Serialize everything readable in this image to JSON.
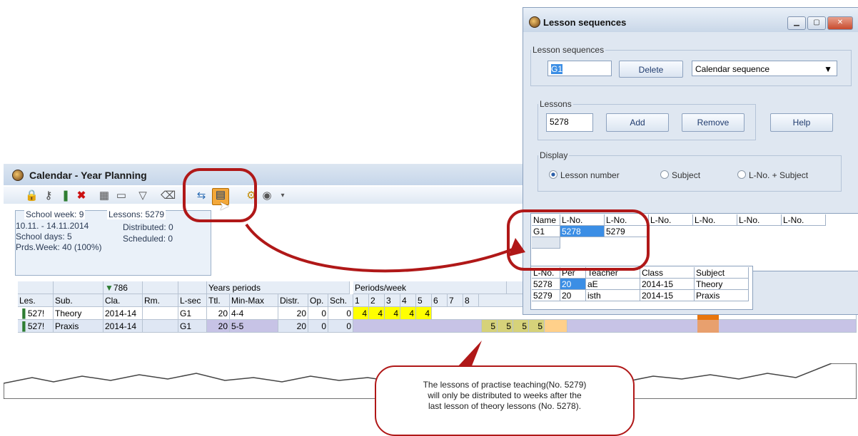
{
  "calendar": {
    "title": "Calendar - Year Planning",
    "info": {
      "school_week": "School week: 9",
      "lessons": "Lessons: 5279",
      "dates": "10.11. - 14.11.2014",
      "distributed": "Distributed: 0",
      "school_days": "School days: 5",
      "scheduled": "Scheduled: 0",
      "prds_week": "Prds.Week: 40 (100%)"
    },
    "filter_count": "786",
    "group_headers": {
      "years_periods": "Years periods",
      "periods_week": "Periods/week"
    },
    "columns": [
      "Les.",
      "Sub.",
      "Cla.",
      "Rm.",
      "L-sec",
      "Ttl.",
      "Min-Max",
      "Distr.",
      "Op.",
      "Sch."
    ],
    "week_numbers": [
      "1",
      "2",
      "3",
      "4",
      "5",
      "6",
      "7",
      "8"
    ],
    "rows": [
      {
        "les": "527!",
        "sub": "Theory",
        "cla": "2014-14",
        "rm": "",
        "lsec": "G1",
        "ttl": "20",
        "minmax": "4-4",
        "distr": "20",
        "op": "0",
        "sch": "0",
        "weeks": [
          "4",
          "4",
          "4",
          "4",
          "4",
          "",
          "",
          ""
        ]
      },
      {
        "les": "527!",
        "sub": "Praxis",
        "cla": "2014-14",
        "rm": "",
        "lsec": "G1",
        "ttl": "20",
        "minmax": "5-5",
        "distr": "20",
        "op": "0",
        "sch": "0",
        "weeks": [
          "",
          "",
          "",
          "",
          "",
          "5",
          "5",
          "5"
        ]
      }
    ],
    "extra_week_value": "5"
  },
  "lesson_sequences": {
    "title": "Lesson sequences",
    "sequences_legend": "Lesson sequences",
    "sequence_value": "G1",
    "delete_label": "Delete",
    "sequence_type": "Calendar sequence",
    "lessons_legend": "Lessons",
    "lesson_value": "5278",
    "add_label": "Add",
    "remove_label": "Remove",
    "help_label": "Help",
    "display_legend": "Display",
    "display_options": [
      "Lesson number",
      "Subject",
      "L-No. + Subject"
    ],
    "seq_table": {
      "headers": [
        "Name",
        "L-No.",
        "L-No.",
        "L-No.",
        "L-No.",
        "L-No.",
        "L-No."
      ],
      "rows": [
        [
          "G1",
          "5278",
          "5279"
        ]
      ]
    },
    "lessons_table": {
      "headers": [
        "L-No.",
        "Per",
        "Teacher",
        "Class",
        "Subject"
      ],
      "rows": [
        [
          "5278",
          "20",
          "aE",
          "2014-15",
          "Theory"
        ],
        [
          "5279",
          "20",
          "isth",
          "2014-15",
          "Praxis"
        ]
      ]
    }
  },
  "callout": {
    "line1": "The lessons of practise teaching(No. 5279)",
    "line2": "will only be distributed to weeks after the",
    "line3": "last lesson of theory lessons (No. 5278)."
  },
  "colors": {
    "accent_red": "#b01818",
    "highlight_yellow": "#ffff00",
    "selection_blue": "#3b8ee5"
  }
}
